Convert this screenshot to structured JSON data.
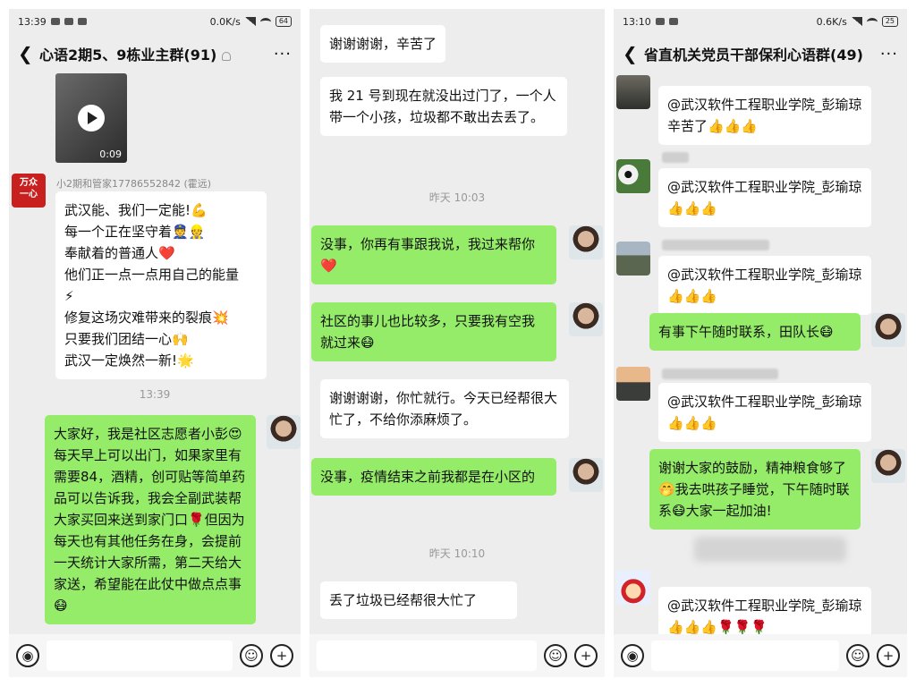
{
  "panel1": {
    "status": {
      "time": "13:39",
      "speed": "0.0K/s",
      "battery": "64"
    },
    "title": "心语2期5、9栋业主群(91)",
    "more": "···",
    "video_duration": "0:09",
    "sender_name": "小2期和管家17786552842 (霍远)",
    "brand_avatar": "万众\n一心",
    "msg1": "武汉能、我们一定能!💪\n每一个正在坚守着👮👷\n奉献着的普通人❤️\n他们正一点一点用自己的能量\n⚡\n修复这场灾难带来的裂痕💥\n只要我们团结一心🙌\n武汉一定焕然一新!🌟",
    "timestamp": "13:39",
    "msg2": "大家好，我是社区志愿者小彭😍每天早上可以出门，如果家里有需要84，酒精，创可贴等简单药品可以告诉我，我会全副武装帮大家买回来送到家门口🌹但因为每天也有其他任务在身，会提前一天统计大家所需，第二天给大家送，希望能在此仗中做点点事😷"
  },
  "panel2": {
    "msg1": "谢谢谢谢，辛苦了",
    "msg2": "我 21 号到现在就没出过门了，一个人带一个小孩，垃圾都不敢出去丢了。",
    "ts1": "昨天 10:03",
    "msg3": "没事，你再有事跟我说，我过来帮你❤️",
    "msg4": "社区的事儿也比较多，只要我有空我就过来😷",
    "msg5": "谢谢谢谢，你忙就行。今天已经帮很大忙了，不给你添麻烦了。",
    "msg6": "没事，疫情结束之前我都是在小区的",
    "ts2": "昨天 10:10",
    "msg7": "丢了垃圾已经帮很大忙了"
  },
  "panel3": {
    "status": {
      "time": "13:10",
      "speed": "0.6K/s",
      "battery": "25"
    },
    "title": "省直机关党员干部保利心语群(49)",
    "more": "···",
    "msg1": "@武汉软件工程职业学院_彭瑜琼  辛苦了👍👍👍",
    "msg2": "@武汉软件工程职业学院_彭瑜琼 👍👍👍",
    "msg3": "@武汉软件工程职业学院_彭瑜琼 👍👍👍",
    "msg4": "有事下午随时联系，田队长😷",
    "msg5": "@武汉软件工程职业学院_彭瑜琼 👍👍👍",
    "msg6": "谢谢大家的鼓励，精神粮食够了🤭我去哄孩子睡觉，下午随时联系😷大家一起加油!",
    "msg7": "@武汉软件工程职业学院_彭瑜琼 👍👍👍🌹🌹🌹"
  },
  "composer": {
    "voice": "◉",
    "emoji": "☺",
    "plus": "+"
  }
}
